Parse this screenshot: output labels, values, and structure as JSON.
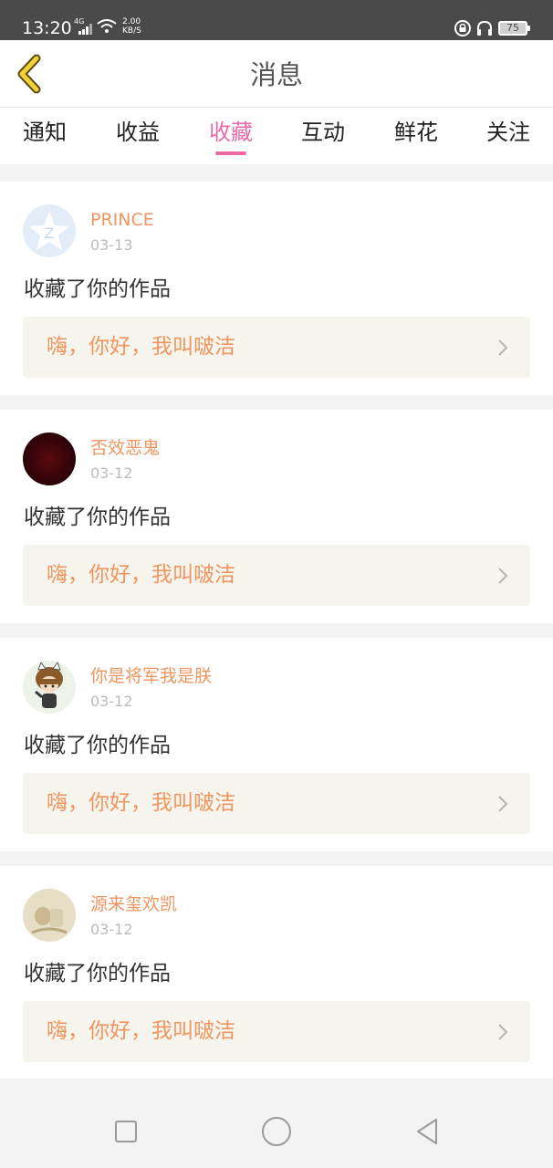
{
  "status_bar": {
    "time": "13:20",
    "network": "4G",
    "speed_value": "2.00",
    "speed_unit": "KB/S",
    "battery": "75",
    "icons": [
      "signal-icon",
      "wifi-icon",
      "lock-icon",
      "headset-icon",
      "battery-icon"
    ]
  },
  "header": {
    "title": "消息",
    "back_icon": "back-chevron-icon"
  },
  "tabs": [
    {
      "label": "通知",
      "active": false
    },
    {
      "label": "收益",
      "active": false
    },
    {
      "label": "收藏",
      "active": true
    },
    {
      "label": "互动",
      "active": false
    },
    {
      "label": "鲜花",
      "active": false
    },
    {
      "label": "关注",
      "active": false
    }
  ],
  "messages": [
    {
      "username": "PRINCE",
      "date": "03-13",
      "action": "收藏了你的作品",
      "work_title": "嗨，你好，我叫啵洁"
    },
    {
      "username": "否效恶鬼",
      "date": "03-12",
      "action": "收藏了你的作品",
      "work_title": "嗨，你好，我叫啵洁"
    },
    {
      "username": "你是将军我是朕",
      "date": "03-12",
      "action": "收藏了你的作品",
      "work_title": "嗨，你好，我叫啵洁"
    },
    {
      "username": "源来玺欢凯",
      "date": "03-12",
      "action": "收藏了你的作品",
      "work_title": "嗨，你好，我叫啵洁"
    }
  ],
  "colors": {
    "accent": "#e86aa6",
    "username": "#f0955f",
    "status_bar_bg": "#4a4a4a",
    "card_link_bg": "#f5f5ee"
  },
  "nav_bar": {
    "icons": [
      "recent-apps-icon",
      "home-icon",
      "back-icon"
    ]
  }
}
